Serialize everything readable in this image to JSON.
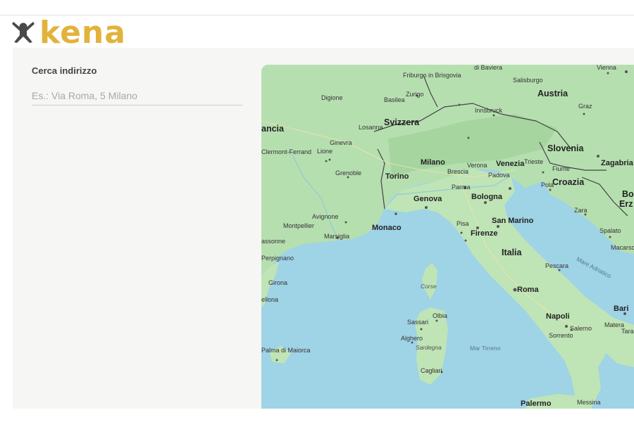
{
  "brand": {
    "logo_text": "kena",
    "logo_icon": "person-mascot-icon",
    "color": "#e2b33c",
    "icon_color": "#4a4a4a"
  },
  "search": {
    "label": "Cerca indirizzo",
    "placeholder": "Es.: Via Roma, 5 Milano",
    "value": ""
  },
  "map": {
    "countries": [
      "Svizzera",
      "Austria",
      "Slovenia",
      "Croazia",
      "Italia",
      "ancia",
      "Bo",
      "Erz"
    ],
    "cities_major": [
      "Monaco",
      "Genova",
      "Torino",
      "Milano",
      "Venezia",
      "Bologna",
      "Firenze",
      "San Marino",
      "Roma",
      "Napoli",
      "Bari",
      "Zagabria",
      "Palermo"
    ],
    "cities_minor": [
      "di Baviera",
      "Friburgo in Brisgovia",
      "Basilea",
      "Zurigo",
      "Salisburgo",
      "Innsbruck",
      "Graz",
      "Digione",
      "Losanna",
      "Ginevra",
      "Lione",
      "Clermont-Ferrand",
      "Grenoble",
      "Brescia",
      "Verona",
      "Padova",
      "Trieste",
      "Fiume",
      "Pola",
      "Parma",
      "Avignone",
      "Montpellier",
      "Marsiglia",
      "assonne",
      "Perpignano",
      "Girona",
      "ellona",
      "Pisa",
      "Zara",
      "Spalato",
      "Macarsc",
      "Pescara",
      "Olbia",
      "Sassari",
      "Alghero",
      "Cagliari",
      "Salerno",
      "Sorrento",
      "Matera",
      "Tara",
      "Messina",
      "Palma di Maiorca",
      "Vienna"
    ],
    "islands": [
      "Corse",
      "Sardegna"
    ],
    "seas": [
      "Mar Tirreno",
      "Mare Adriatico"
    ]
  }
}
